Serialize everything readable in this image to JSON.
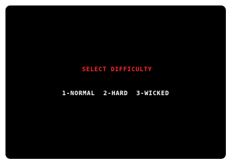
{
  "prompt": "SELECT DIFFICULTY",
  "options": [
    {
      "key": "1",
      "label": "NORMAL",
      "text": "1-NORMAL"
    },
    {
      "key": "2",
      "label": "HARD",
      "text": "2-HARD"
    },
    {
      "key": "3",
      "label": "WICKED",
      "text": "3-WICKED"
    }
  ],
  "colors": {
    "screen_background": "#000000",
    "prompt_color": "#ff2a2a",
    "option_color": "#ffffff",
    "page_background": "#ffffff"
  }
}
